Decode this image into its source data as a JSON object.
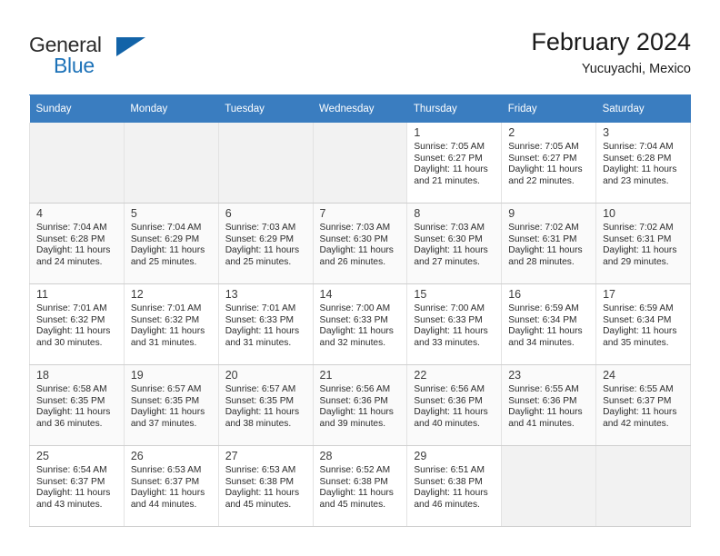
{
  "brand": {
    "name_part1": "General",
    "name_part2": "Blue",
    "logo_icon": "triangle-flag-icon"
  },
  "header": {
    "title": "February 2024",
    "subtitle": "Yucuyachi, Mexico"
  },
  "colors": {
    "header_row_bg": "#3a7dc0",
    "brand_blue": "#1d72b8",
    "alt_row_bg": "#fafafa",
    "empty_cell_bg": "#f2f2f2"
  },
  "weekday_headers": [
    "Sunday",
    "Monday",
    "Tuesday",
    "Wednesday",
    "Thursday",
    "Friday",
    "Saturday"
  ],
  "weeks": [
    [
      {
        "empty": true
      },
      {
        "empty": true
      },
      {
        "empty": true
      },
      {
        "empty": true
      },
      {
        "day": "1",
        "sunrise": "Sunrise: 7:05 AM",
        "sunset": "Sunset: 6:27 PM",
        "daylight1": "Daylight: 11 hours",
        "daylight2": "and 21 minutes."
      },
      {
        "day": "2",
        "sunrise": "Sunrise: 7:05 AM",
        "sunset": "Sunset: 6:27 PM",
        "daylight1": "Daylight: 11 hours",
        "daylight2": "and 22 minutes."
      },
      {
        "day": "3",
        "sunrise": "Sunrise: 7:04 AM",
        "sunset": "Sunset: 6:28 PM",
        "daylight1": "Daylight: 11 hours",
        "daylight2": "and 23 minutes."
      }
    ],
    [
      {
        "day": "4",
        "sunrise": "Sunrise: 7:04 AM",
        "sunset": "Sunset: 6:28 PM",
        "daylight1": "Daylight: 11 hours",
        "daylight2": "and 24 minutes."
      },
      {
        "day": "5",
        "sunrise": "Sunrise: 7:04 AM",
        "sunset": "Sunset: 6:29 PM",
        "daylight1": "Daylight: 11 hours",
        "daylight2": "and 25 minutes."
      },
      {
        "day": "6",
        "sunrise": "Sunrise: 7:03 AM",
        "sunset": "Sunset: 6:29 PM",
        "daylight1": "Daylight: 11 hours",
        "daylight2": "and 25 minutes."
      },
      {
        "day": "7",
        "sunrise": "Sunrise: 7:03 AM",
        "sunset": "Sunset: 6:30 PM",
        "daylight1": "Daylight: 11 hours",
        "daylight2": "and 26 minutes."
      },
      {
        "day": "8",
        "sunrise": "Sunrise: 7:03 AM",
        "sunset": "Sunset: 6:30 PM",
        "daylight1": "Daylight: 11 hours",
        "daylight2": "and 27 minutes."
      },
      {
        "day": "9",
        "sunrise": "Sunrise: 7:02 AM",
        "sunset": "Sunset: 6:31 PM",
        "daylight1": "Daylight: 11 hours",
        "daylight2": "and 28 minutes."
      },
      {
        "day": "10",
        "sunrise": "Sunrise: 7:02 AM",
        "sunset": "Sunset: 6:31 PM",
        "daylight1": "Daylight: 11 hours",
        "daylight2": "and 29 minutes."
      }
    ],
    [
      {
        "day": "11",
        "sunrise": "Sunrise: 7:01 AM",
        "sunset": "Sunset: 6:32 PM",
        "daylight1": "Daylight: 11 hours",
        "daylight2": "and 30 minutes."
      },
      {
        "day": "12",
        "sunrise": "Sunrise: 7:01 AM",
        "sunset": "Sunset: 6:32 PM",
        "daylight1": "Daylight: 11 hours",
        "daylight2": "and 31 minutes."
      },
      {
        "day": "13",
        "sunrise": "Sunrise: 7:01 AM",
        "sunset": "Sunset: 6:33 PM",
        "daylight1": "Daylight: 11 hours",
        "daylight2": "and 31 minutes."
      },
      {
        "day": "14",
        "sunrise": "Sunrise: 7:00 AM",
        "sunset": "Sunset: 6:33 PM",
        "daylight1": "Daylight: 11 hours",
        "daylight2": "and 32 minutes."
      },
      {
        "day": "15",
        "sunrise": "Sunrise: 7:00 AM",
        "sunset": "Sunset: 6:33 PM",
        "daylight1": "Daylight: 11 hours",
        "daylight2": "and 33 minutes."
      },
      {
        "day": "16",
        "sunrise": "Sunrise: 6:59 AM",
        "sunset": "Sunset: 6:34 PM",
        "daylight1": "Daylight: 11 hours",
        "daylight2": "and 34 minutes."
      },
      {
        "day": "17",
        "sunrise": "Sunrise: 6:59 AM",
        "sunset": "Sunset: 6:34 PM",
        "daylight1": "Daylight: 11 hours",
        "daylight2": "and 35 minutes."
      }
    ],
    [
      {
        "day": "18",
        "sunrise": "Sunrise: 6:58 AM",
        "sunset": "Sunset: 6:35 PM",
        "daylight1": "Daylight: 11 hours",
        "daylight2": "and 36 minutes."
      },
      {
        "day": "19",
        "sunrise": "Sunrise: 6:57 AM",
        "sunset": "Sunset: 6:35 PM",
        "daylight1": "Daylight: 11 hours",
        "daylight2": "and 37 minutes."
      },
      {
        "day": "20",
        "sunrise": "Sunrise: 6:57 AM",
        "sunset": "Sunset: 6:35 PM",
        "daylight1": "Daylight: 11 hours",
        "daylight2": "and 38 minutes."
      },
      {
        "day": "21",
        "sunrise": "Sunrise: 6:56 AM",
        "sunset": "Sunset: 6:36 PM",
        "daylight1": "Daylight: 11 hours",
        "daylight2": "and 39 minutes."
      },
      {
        "day": "22",
        "sunrise": "Sunrise: 6:56 AM",
        "sunset": "Sunset: 6:36 PM",
        "daylight1": "Daylight: 11 hours",
        "daylight2": "and 40 minutes."
      },
      {
        "day": "23",
        "sunrise": "Sunrise: 6:55 AM",
        "sunset": "Sunset: 6:36 PM",
        "daylight1": "Daylight: 11 hours",
        "daylight2": "and 41 minutes."
      },
      {
        "day": "24",
        "sunrise": "Sunrise: 6:55 AM",
        "sunset": "Sunset: 6:37 PM",
        "daylight1": "Daylight: 11 hours",
        "daylight2": "and 42 minutes."
      }
    ],
    [
      {
        "day": "25",
        "sunrise": "Sunrise: 6:54 AM",
        "sunset": "Sunset: 6:37 PM",
        "daylight1": "Daylight: 11 hours",
        "daylight2": "and 43 minutes."
      },
      {
        "day": "26",
        "sunrise": "Sunrise: 6:53 AM",
        "sunset": "Sunset: 6:37 PM",
        "daylight1": "Daylight: 11 hours",
        "daylight2": "and 44 minutes."
      },
      {
        "day": "27",
        "sunrise": "Sunrise: 6:53 AM",
        "sunset": "Sunset: 6:38 PM",
        "daylight1": "Daylight: 11 hours",
        "daylight2": "and 45 minutes."
      },
      {
        "day": "28",
        "sunrise": "Sunrise: 6:52 AM",
        "sunset": "Sunset: 6:38 PM",
        "daylight1": "Daylight: 11 hours",
        "daylight2": "and 45 minutes."
      },
      {
        "day": "29",
        "sunrise": "Sunrise: 6:51 AM",
        "sunset": "Sunset: 6:38 PM",
        "daylight1": "Daylight: 11 hours",
        "daylight2": "and 46 minutes."
      },
      {
        "empty": true
      },
      {
        "empty": true
      }
    ]
  ]
}
